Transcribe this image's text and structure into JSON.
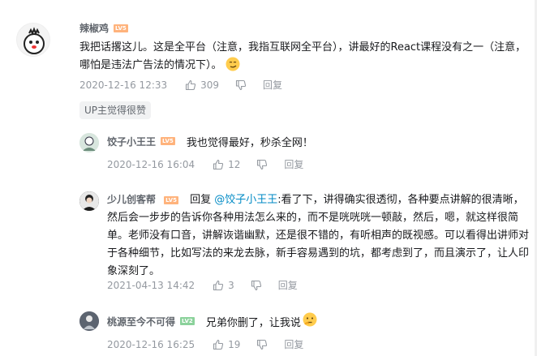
{
  "main_comment": {
    "username": "辣椒鸡",
    "level": "LV5",
    "content": "我把话撂这儿。这是全平台（注意，我指互联网全平台），讲最好的React课程没有之一（注意，哪怕是违法广告法的情况下）。",
    "emoji": "smirk-emoji",
    "date": "2020-12-16 12:33",
    "likes": "309",
    "reply_label": "回复",
    "up_tag": "UP主觉得很赞"
  },
  "replies": [
    {
      "username": "饺子小王王",
      "level": "LV5",
      "content": "我也觉得最好，秒杀全网！",
      "date": "2020-12-16 16:04",
      "likes": "12",
      "reply_label": "回复"
    },
    {
      "username": "少儿创客帮",
      "level": "LV5",
      "reply_prefix": "回复 ",
      "mention": "@饺子小王王",
      "content": ":看了下，讲得确实很透彻，各种要点讲解的很清晰，然后会一步步的告诉你各种用法怎么来的，而不是咣咣咣一顿敲，然后，嗯，就这样很简单。老师没有口音，讲解诙谐幽默，还是很不错的，有听相声的既视感。可以看得出讲师对于各种细节，比如写法的来龙去脉，新手容易遇到的坑，都考虑到了，而且演示了，让人印象深刻了。",
      "date": "2021-04-13 14:42",
      "likes": "3",
      "reply_label": "回复"
    },
    {
      "username": "桃源至今不可得",
      "level": "LV2",
      "content": "兄弟你删了，让我说",
      "emoji": "thinking-emoji",
      "date": "2020-12-16 16:25",
      "likes": "19",
      "reply_label": "回复"
    }
  ],
  "colors": {
    "lv5": "#ffb37c",
    "lv2": "#8bd29b",
    "mention": "#008ac5",
    "meta": "#9499a0"
  }
}
